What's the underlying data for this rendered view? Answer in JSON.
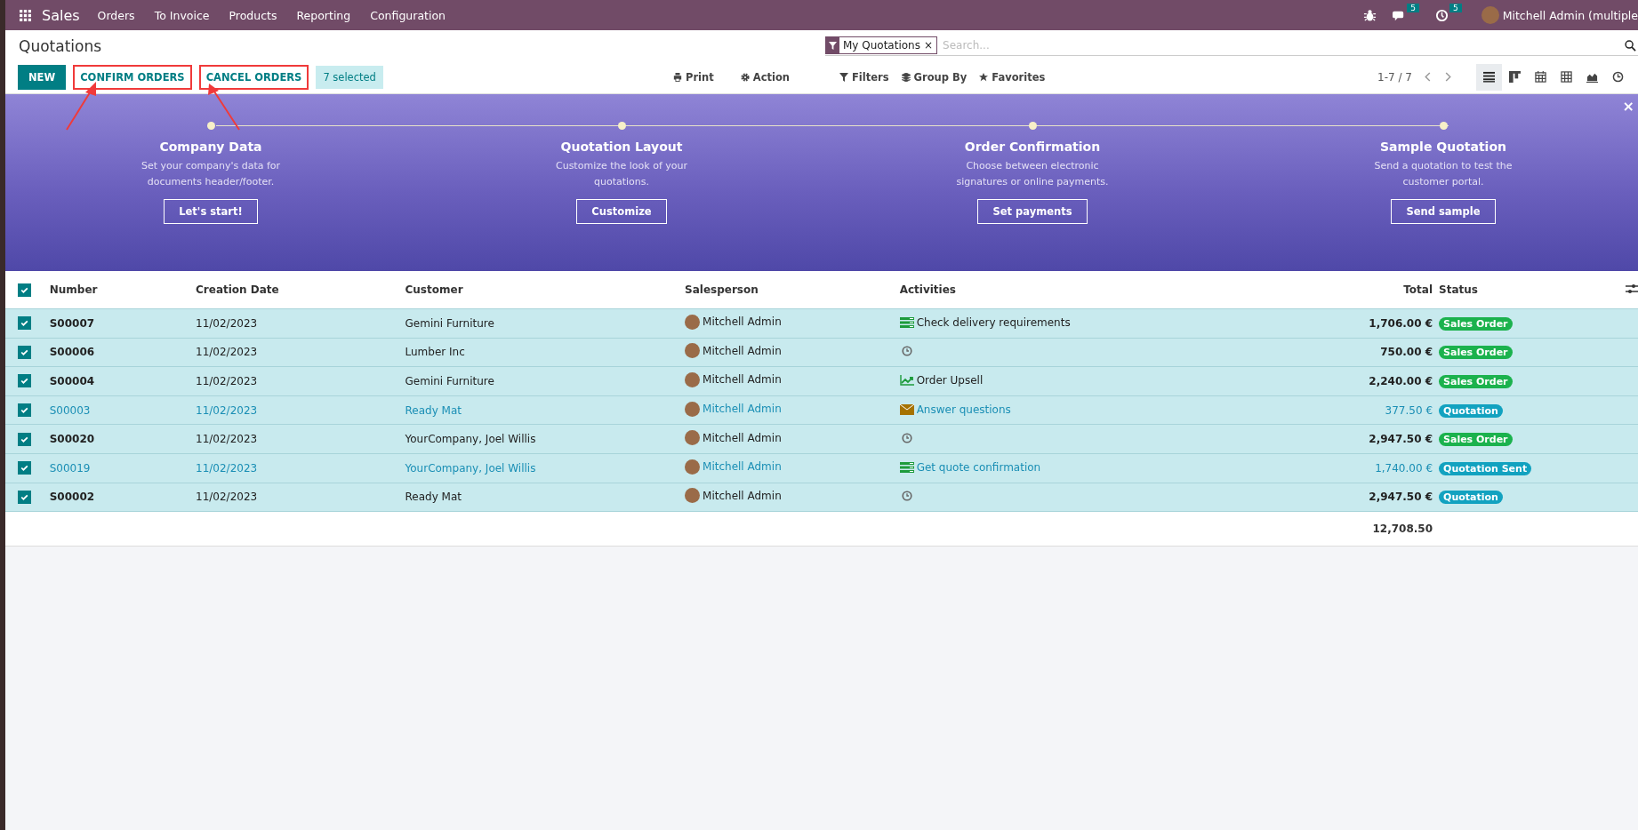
{
  "navbar": {
    "app": "Sales",
    "menu": [
      "Orders",
      "To Invoice",
      "Products",
      "Reporting",
      "Configuration"
    ],
    "messages_count": "5",
    "activities_count": "5",
    "user": "Mitchell Admin (multiple"
  },
  "control_panel": {
    "title": "Quotations",
    "search": {
      "facet": "My Quotations",
      "facet_remove": "×",
      "placeholder": "Search..."
    },
    "buttons": [
      {
        "label": "NEW",
        "kind": "primary",
        "annotated": false
      },
      {
        "label": "CONFIRM ORDERS",
        "kind": "secondary",
        "annotated": true
      },
      {
        "label": "CANCEL ORDERS",
        "kind": "secondary",
        "annotated": true
      }
    ],
    "selected_count": "7 selected",
    "print": "Print",
    "action": "Action",
    "filters": "Filters",
    "group_by": "Group By",
    "favorites": "Favorites",
    "pager": "1-7 / 7",
    "views": [
      {
        "kind": "list",
        "selected": true
      },
      {
        "kind": "kanban",
        "selected": false
      },
      {
        "kind": "calendar",
        "selected": false
      },
      {
        "kind": "pivot",
        "selected": false
      },
      {
        "kind": "graph",
        "selected": false
      },
      {
        "kind": "activity",
        "selected": false
      }
    ]
  },
  "banner": {
    "close": "×",
    "steps": [
      {
        "title": "Company Data",
        "description": "Set your company's data for documents header/footer.",
        "button": "Let's start!"
      },
      {
        "title": "Quotation Layout",
        "description": "Customize the look of your quotations.",
        "button": "Customize"
      },
      {
        "title": "Order Confirmation",
        "description": "Choose between electronic signatures or online payments.",
        "button": "Set payments"
      },
      {
        "title": "Sample Quotation",
        "description": "Send a quotation to test the customer portal.",
        "button": "Send sample"
      }
    ]
  },
  "table": {
    "all_checked": true,
    "columns": [
      "Number",
      "Creation Date",
      "Customer",
      "Salesperson",
      "Activities",
      "Total",
      "Status"
    ],
    "rows": [
      {
        "checked": true,
        "info": false,
        "number": "S00007",
        "date": "11/02/2023",
        "customer": "Gemini Furniture",
        "salesperson": "Mitchell Admin",
        "kind": "list",
        "activity": "Check delivery requirements",
        "total": "1,706.00 €",
        "status": "Sales Order",
        "color": "#1bb24d"
      },
      {
        "checked": true,
        "info": false,
        "number": "S00006",
        "date": "11/02/2023",
        "customer": "Lumber Inc",
        "salesperson": "Mitchell Admin",
        "kind": "clock",
        "total": "750.00 €",
        "status": "Sales Order",
        "color": "#1bb24d"
      },
      {
        "checked": true,
        "info": false,
        "number": "S00004",
        "date": "11/02/2023",
        "customer": "Gemini Furniture",
        "salesperson": "Mitchell Admin",
        "kind": "chart",
        "activity": "Order Upsell",
        "total": "2,240.00 €",
        "status": "Sales Order",
        "color": "#1bb24d"
      },
      {
        "checked": true,
        "info": true,
        "number": "S00003",
        "date": "11/02/2023",
        "customer": "Ready Mat",
        "salesperson": "Mitchell Admin",
        "kind": "mail",
        "activity": "Answer questions",
        "total": "377.50 €",
        "status": "Quotation",
        "color": "#12a2c0"
      },
      {
        "checked": true,
        "info": false,
        "number": "S00020",
        "date": "11/02/2023",
        "customer": "YourCompany, Joel Willis",
        "salesperson": "Mitchell Admin",
        "kind": "clock",
        "total": "2,947.50 €",
        "status": "Sales Order",
        "color": "#1bb24d"
      },
      {
        "checked": true,
        "info": true,
        "number": "S00019",
        "date": "11/02/2023",
        "customer": "YourCompany, Joel Willis",
        "salesperson": "Mitchell Admin",
        "kind": "list",
        "activity": "Get quote confirmation",
        "total": "1,740.00 €",
        "status": "Quotation Sent",
        "color": "#12a2c0"
      },
      {
        "checked": true,
        "info": false,
        "number": "S00002",
        "date": "11/02/2023",
        "customer": "Ready Mat",
        "salesperson": "Mitchell Admin",
        "kind": "clock",
        "total": "2,947.50 €",
        "status": "Quotation",
        "color": "#12a2c0"
      }
    ],
    "sum": "12,708.50"
  }
}
